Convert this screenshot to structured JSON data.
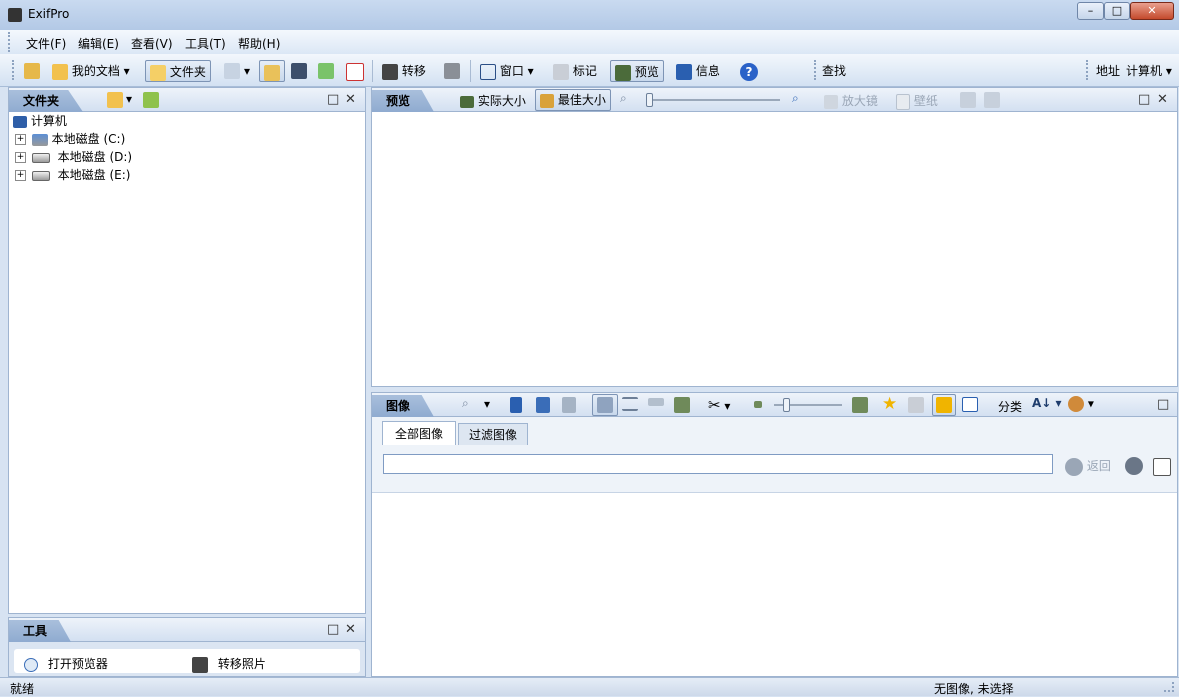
{
  "window": {
    "title": "ExifPro",
    "minimize": "–",
    "maximize": "□",
    "close": "✕"
  },
  "menu": [
    "文件(F)",
    "编辑(E)",
    "查看(V)",
    "工具(T)",
    "帮助(H)"
  ],
  "toolbar": {
    "my_documents": "我的文档",
    "folders": "文件夹",
    "transfer": "转移",
    "window": "窗口",
    "tag": "标记",
    "preview": "预览",
    "info": "信息",
    "find_label": "查找",
    "find_value": "",
    "address_label": "地址",
    "address_value": "计算机"
  },
  "folders_panel": {
    "tab": "文件夹",
    "tree": {
      "root": "计算机",
      "items": [
        "本地磁盘 (C:)",
        "本地磁盘 (D:)",
        "本地磁盘 (E:)"
      ]
    }
  },
  "tools_panel": {
    "tab": "工具",
    "items": [
      "打开预览器",
      "转移照片"
    ]
  },
  "preview_panel": {
    "tab": "预览",
    "actual_size": "实际大小",
    "best_fit": "最佳大小",
    "magnifier": "放大镜",
    "wallpaper": "壁纸",
    "zoom_level": 0.0
  },
  "images_panel": {
    "tab": "图像",
    "sort_label": "分类",
    "tabs": [
      "全部图像",
      "过滤图像"
    ],
    "filter_value": "",
    "back_label": "返回",
    "thumb_size_level": 0.15
  },
  "status": {
    "left": "就绪",
    "right": "无图像, 未选择"
  },
  "colors": {
    "accent": "#0a64c8",
    "panel_border": "#9fb4d0",
    "background": "#d7e3f2"
  }
}
